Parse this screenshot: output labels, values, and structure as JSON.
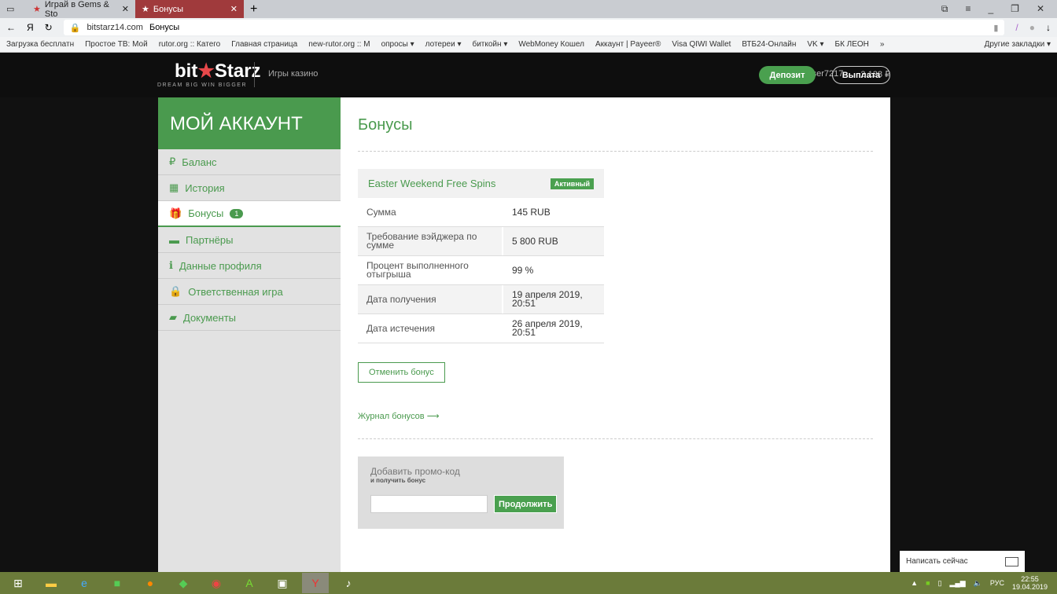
{
  "browser": {
    "tabs": [
      {
        "label": "Играй в Gems & Sto"
      },
      {
        "label": "Бонусы"
      }
    ],
    "url_domain": "bitstarz14.com",
    "url_title": "Бонусы",
    "bookmarks": [
      "Загрузка бесплатн",
      "Простое ТВ: Мой",
      "rutor.org :: Катего",
      "Главная страница",
      "new-rutor.org :: М",
      "опросы ▾",
      "лотереи ▾",
      "биткойн ▾",
      "WebMoney Кошел",
      "Аккаунт | Payeer®",
      "Visa QIWI Wallet",
      "ВТБ24-Онлайн",
      "VK ▾",
      "БК ЛЕОН",
      "»"
    ],
    "other_bookmarks": "Другие закладки ▾"
  },
  "header": {
    "logo_main_a": "bit",
    "logo_main_b": "Starz",
    "logo_tag": "DREAM BIG  WIN BIGGER",
    "games": "Игры казино",
    "username": "ser7217",
    "balance": "2 128 ₽",
    "deposit": "Депозит",
    "withdraw": "Выплата"
  },
  "sidebar": {
    "title": "МОЙ АККАУНТ",
    "items": [
      {
        "label": "Баланс",
        "icon": "₽"
      },
      {
        "label": "История",
        "icon": "▦"
      },
      {
        "label": "Бонусы",
        "icon": "🎁",
        "badge": "1"
      },
      {
        "label": "Партнёры",
        "icon": "▬"
      },
      {
        "label": "Данные профиля",
        "icon": "ℹ"
      },
      {
        "label": "Ответственная игра",
        "icon": "🔒"
      },
      {
        "label": "Документы",
        "icon": "▰"
      }
    ]
  },
  "main": {
    "title": "Бонусы",
    "bonus": {
      "name": "Easter Weekend Free Spins",
      "status": "Активный",
      "rows": [
        {
          "k": "Сумма",
          "v": "145 RUB"
        },
        {
          "k": "Требование вэйджера по сумме",
          "v": "5 800 RUB"
        },
        {
          "k": "Процент выполненного отыгрыша",
          "v": "99 %"
        },
        {
          "k": "Дата получения",
          "v": "19 апреля 2019, 20:51"
        },
        {
          "k": "Дата истечения",
          "v": "26 апреля 2019, 20:51"
        }
      ]
    },
    "cancel": "Отменить бонус",
    "journal": "Журнал бонусов ⟶",
    "promo": {
      "t1": "Добавить промо-код",
      "t2": "и получить бонус",
      "input": "",
      "submit": "Продолжить"
    }
  },
  "chat": "Написать сейчас",
  "tray": {
    "lang": "РУС",
    "time": "22:55",
    "date": "19.04.2019"
  }
}
